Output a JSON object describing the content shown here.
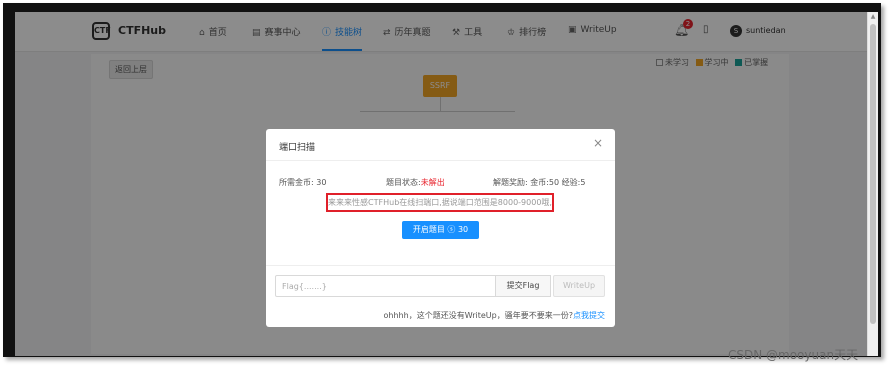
{
  "nav": {
    "brand": "CTFHub",
    "logo_text": "CTF",
    "items": [
      {
        "icon": "home-icon",
        "glyph": "⌂",
        "label": "首页"
      },
      {
        "icon": "event-icon",
        "glyph": "▤",
        "label": "赛事中心"
      },
      {
        "icon": "skill-tree-icon",
        "glyph": "ⓘ",
        "label": "技能树"
      },
      {
        "icon": "history-icon",
        "glyph": "⇄",
        "label": "历年真题"
      },
      {
        "icon": "tools-icon",
        "glyph": "⚒",
        "label": "工具"
      },
      {
        "icon": "ranking-icon",
        "glyph": "♔",
        "label": "排行榜"
      },
      {
        "icon": "writeup-icon",
        "glyph": "▣",
        "label": "WriteUp"
      }
    ],
    "active_item": "技能树",
    "notification_count": "2",
    "avatar_letter": "S",
    "username": "suntiedan"
  },
  "page": {
    "back_button": "返回上层",
    "legend": [
      {
        "label": "未学习",
        "color": "#ffffff"
      },
      {
        "label": "学习中",
        "color": "#f3a626"
      },
      {
        "label": "已掌握",
        "color": "#1aa39a"
      }
    ],
    "tree_root": "SSRF"
  },
  "modal": {
    "title": "端口扫描",
    "close_glyph": "×",
    "cost_label": "所需金币: 30",
    "status_label": "题目状态:",
    "status_value": "未解出",
    "reward_label": "解题奖励: 金币:50 经验:5",
    "hint": "来来来性感CTFHub在线扫端口,据说端口范围是8000-9000哦,",
    "start_button": "开启题目 ⓢ 30",
    "flag_placeholder": "Flag{.......}",
    "submit_button": "提交Flag",
    "writeup_button": "WriteUp",
    "footer_text": "ohhhh，这个题还没有WriteUp，骚年要不要来一份?",
    "footer_link": "点我提交"
  },
  "watermark": "CSDN @mooyuan天天",
  "colors": {
    "accent": "#1890ff",
    "danger": "#e8242e",
    "learning": "#f3a626",
    "mastered": "#1aa39a"
  }
}
